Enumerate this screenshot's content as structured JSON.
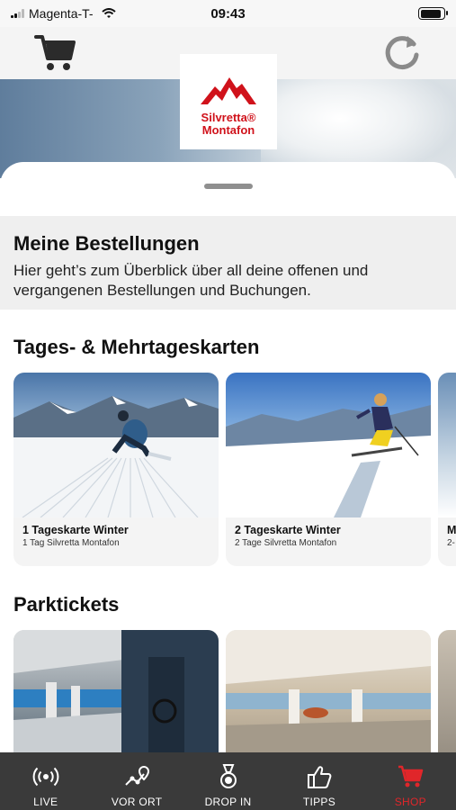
{
  "status_bar": {
    "carrier": "Magenta-T-",
    "time": "09:43",
    "battery_level": 0.9
  },
  "header": {
    "cart_icon": "shopping-cart-icon",
    "refresh_icon": "refresh-icon"
  },
  "logo": {
    "line1": "Silvretta®",
    "line2": "Montafon",
    "brand_color": "#d0121b"
  },
  "orders": {
    "title": "Meine Bestellungen",
    "description": "Hier geht’s zum Überblick über all deine offenen und vergangenen Bestellungen und Buchungen."
  },
  "day_tickets": {
    "title": "Tages- & Mehrtageskarten",
    "items": [
      {
        "title": "1 Tageskarte Winter",
        "subtitle": "1 Tag Silvretta Montafon"
      },
      {
        "title": "2 Tageskarte Winter",
        "subtitle": "2 Tage Silvretta Montafon"
      },
      {
        "title": "M",
        "subtitle": "2-"
      }
    ]
  },
  "park_tickets": {
    "title": "Parktickets"
  },
  "tab_bar": {
    "active_color": "#e0262a",
    "items": [
      {
        "label": "LIVE",
        "icon": "broadcast-icon"
      },
      {
        "label": "VOR ORT",
        "icon": "map-route-icon"
      },
      {
        "label": "DROP IN",
        "icon": "medal-icon"
      },
      {
        "label": "TIPPS",
        "icon": "thumbs-up-icon"
      },
      {
        "label": "SHOP",
        "icon": "shopping-cart-icon"
      }
    ]
  }
}
